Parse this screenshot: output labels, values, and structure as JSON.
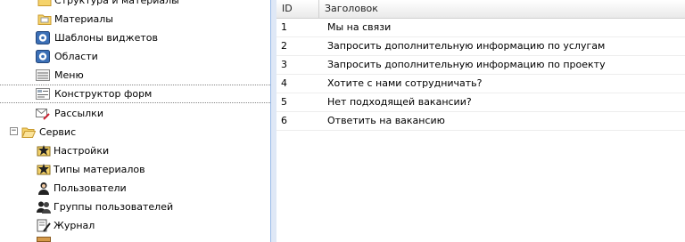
{
  "tree": {
    "items": [
      {
        "label": "Структура и материалы",
        "icon": "folder-icon"
      },
      {
        "label": "Материалы",
        "icon": "document-folder-icon"
      },
      {
        "label": "Шаблоны виджетов",
        "icon": "gear-icon"
      },
      {
        "label": "Области",
        "icon": "gear-icon"
      },
      {
        "label": "Меню",
        "icon": "menu-list-icon"
      },
      {
        "label": "Конструктор форм",
        "icon": "form-icon"
      },
      {
        "label": "Рассылки",
        "icon": "mail-pencil-icon"
      },
      {
        "label": "Сервис",
        "icon": "folder-open-icon",
        "toggle": "−"
      },
      {
        "label": "Настройки",
        "icon": "settings-star-icon"
      },
      {
        "label": "Типы материалов",
        "icon": "types-star-icon"
      },
      {
        "label": "Пользователи",
        "icon": "user-icon"
      },
      {
        "label": "Группы пользователей",
        "icon": "users-group-icon"
      },
      {
        "label": "Журнал",
        "icon": "journal-pen-icon"
      }
    ]
  },
  "grid": {
    "columns": {
      "id": "ID",
      "title": "Заголовок"
    },
    "rows": [
      {
        "id": "1",
        "title": "Мы на связи"
      },
      {
        "id": "2",
        "title": "Запросить дополнительную информацию по услугам"
      },
      {
        "id": "3",
        "title": "Запросить дополнительную информацию по проекту"
      },
      {
        "id": "4",
        "title": "Хотите с нами сотрудничать?"
      },
      {
        "id": "5",
        "title": "Нет подходящей вакансии?"
      },
      {
        "id": "6",
        "title": "Ответить на вакансию"
      }
    ]
  },
  "colors": {
    "panel_bg": "#dfe8f6",
    "border": "#99bbe8",
    "folder": "#f5d36b",
    "gear": "#3b6fb6"
  }
}
